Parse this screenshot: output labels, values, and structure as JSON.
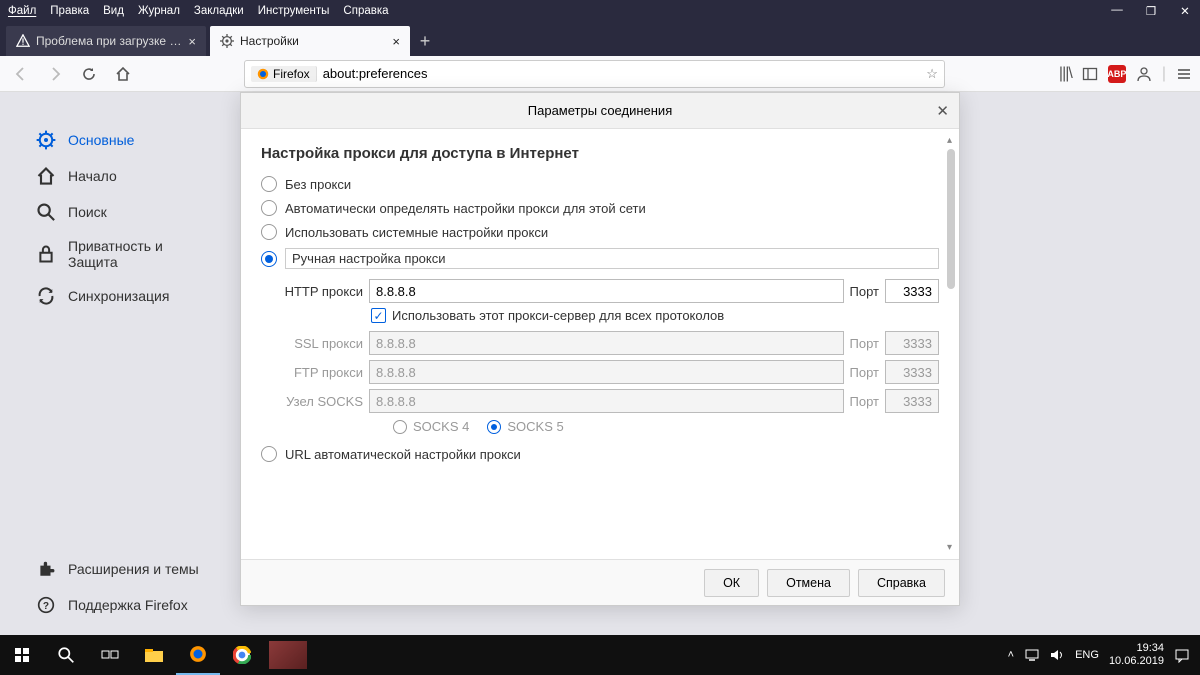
{
  "menubar": {
    "items": [
      "Файл",
      "Правка",
      "Вид",
      "Журнал",
      "Закладки",
      "Инструменты",
      "Справка"
    ]
  },
  "tabs": {
    "inactive_label": "Проблема при загрузке стран",
    "active_label": "Настройки"
  },
  "urlbar": {
    "brand": "Firefox",
    "url": "about:preferences"
  },
  "sidebar": {
    "general": "Основные",
    "home": "Начало",
    "search": "Поиск",
    "privacy": "Приватность и Защита",
    "sync": "Синхронизация",
    "extensions": "Расширения и темы",
    "support": "Поддержка Firefox"
  },
  "dialog": {
    "title": "Параметры соединения",
    "heading": "Настройка прокси для доступа в Интернет",
    "radio_no_proxy": "Без прокси",
    "radio_auto": "Автоматически определять настройки прокси для этой сети",
    "radio_system": "Использовать системные настройки прокси",
    "radio_manual": "Ручная настройка прокси",
    "http_label": "HTTP прокси",
    "ssl_label": "SSL прокси",
    "ftp_label": "FTP прокси",
    "socks_label": "Узел SOCKS",
    "port_label": "Порт",
    "http_host": "8.8.8.8",
    "http_port": "3333",
    "disabled_host": "8.8.8.8",
    "disabled_port": "3333",
    "use_for_all": "Использовать этот прокси-сервер для всех протоколов",
    "socks4": "SOCKS 4",
    "socks5": "SOCKS 5",
    "radio_pac": "URL автоматической настройки прокси",
    "ok": "ОК",
    "cancel": "Отмена",
    "help": "Справка"
  },
  "tray": {
    "lang": "ENG",
    "time": "19:34",
    "date": "10.06.2019"
  },
  "toolbar_icons": {
    "abp": "ABP"
  }
}
